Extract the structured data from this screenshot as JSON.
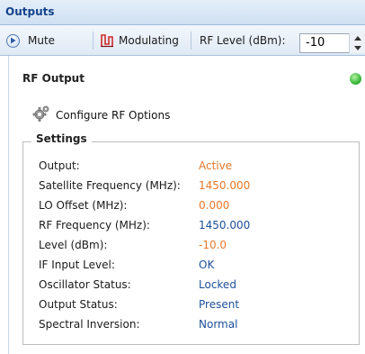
{
  "panel": {
    "title": "Outputs"
  },
  "toolbar": {
    "mute_label": "Mute",
    "modulating_label": "Modulating",
    "rf_level_label": "RF Level (dBm):",
    "rf_level_value": "-10"
  },
  "rf_output": {
    "title": "RF Output",
    "status_color": "#3cb83c",
    "configure_label": "Configure RF Options"
  },
  "settings": {
    "legend": "Settings",
    "rows": [
      {
        "label": "Output:",
        "value": "Active",
        "color": "orange"
      },
      {
        "label": "Satellite Frequency (MHz):",
        "value": "1450.000",
        "color": "orange"
      },
      {
        "label": "LO Offset (MHz):",
        "value": "0.000",
        "color": "orange"
      },
      {
        "label": "RF Frequency (MHz):",
        "value": "1450.000",
        "color": "blue"
      },
      {
        "label": "Level (dBm):",
        "value": "-10.0",
        "color": "orange"
      },
      {
        "label": "IF Input Level:",
        "value": "OK",
        "color": "blue"
      },
      {
        "label": "Oscillator Status:",
        "value": "Locked",
        "color": "blue"
      },
      {
        "label": "Output Status:",
        "value": "Present",
        "color": "blue"
      },
      {
        "label": "Spectral Inversion:",
        "value": "Normal",
        "color": "blue"
      }
    ]
  },
  "colors": {
    "orange": "#e8782c",
    "blue": "#1d4f9a",
    "header_text": "#15428b"
  }
}
